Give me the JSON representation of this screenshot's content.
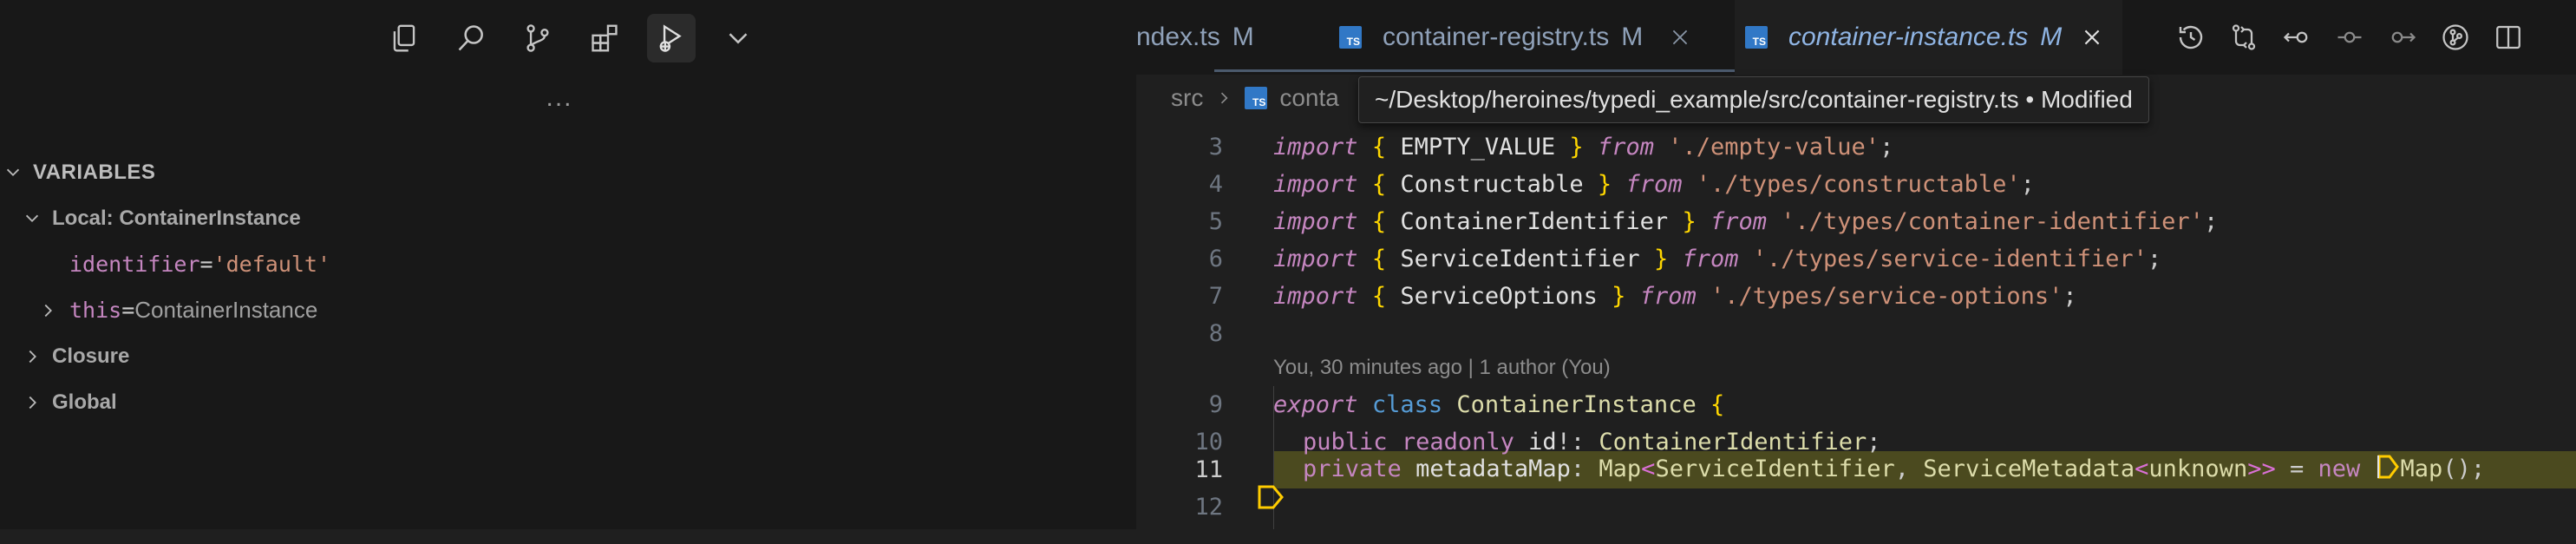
{
  "sidebar": {
    "toolbar_icons": [
      "copy-icon",
      "search-icon",
      "source-control-icon",
      "extensions-icon",
      "run-debug-icon",
      "chevron-down-icon"
    ],
    "more": "...",
    "variables": {
      "title": "VARIABLES",
      "scopes": [
        {
          "label": "Local: ContainerInstance",
          "expanded": true,
          "items": [
            {
              "name": "identifier",
              "eq": " = ",
              "value": "'default'"
            },
            {
              "name": "this",
              "eq": " = ",
              "value": "ContainerInstance"
            }
          ]
        },
        {
          "label": "Closure",
          "expanded": false
        },
        {
          "label": "Global",
          "expanded": false
        }
      ]
    }
  },
  "editor": {
    "tabs": [
      {
        "label": "ndex.ts",
        "status": "M"
      },
      {
        "label": "container-registry.ts",
        "status": "M"
      },
      {
        "label": "container-instance.ts",
        "status": "M",
        "active": true
      }
    ],
    "ts_badge": "TS",
    "breadcrumb": {
      "root": "src",
      "file": "conta"
    },
    "tooltip": {
      "path": "~/Desktop/heroines/typedi_example/src/container-registry.ts",
      "separator": " • ",
      "status": "Modified"
    },
    "blame": "You, 30 minutes ago | 1 author (You)",
    "line_numbers": [
      "3",
      "4",
      "5",
      "6",
      "7",
      "8",
      "9",
      "10",
      "11",
      "12"
    ],
    "lines": {
      "l3": {
        "kw": "import",
        "open": "{",
        "name": " EMPTY_VALUE ",
        "close": "}",
        "from": "from",
        "path": "'./empty-value'",
        "end": ";"
      },
      "l4": {
        "kw": "import",
        "open": "{",
        "name": " Constructable ",
        "close": "}",
        "from": "from",
        "path": "'./types/constructable'",
        "end": ";"
      },
      "l5": {
        "kw": "import",
        "open": "{",
        "name": " ContainerIdentifier ",
        "close": "}",
        "from": "from",
        "path": "'./types/container-identifier'",
        "end": ";"
      },
      "l6": {
        "kw": "import",
        "open": "{",
        "name": " ServiceIdentifier ",
        "close": "}",
        "from": "from",
        "path": "'./types/service-identifier'",
        "end": ";"
      },
      "l7": {
        "kw": "import",
        "open": "{",
        "name": " ServiceOptions ",
        "close": "}",
        "from": "from",
        "path": "'./types/service-options'",
        "end": ";"
      },
      "l9": {
        "export": "export",
        "class": "class",
        "name": "ContainerInstance",
        "open": "{"
      },
      "l10": {
        "public": "public",
        "readonly": "readonly",
        "prop": "id",
        "bang": "!: ",
        "type": "ContainerIdentifier",
        "end": ";"
      },
      "l11": {
        "private": "private",
        "prop": "metadataMap",
        "colon": ": ",
        "map": "Map",
        "lt": "<",
        "t1": "ServiceIdentifier",
        "comma": ", ",
        "t2": "ServiceMetadata",
        "lt2": "<",
        "t3": "unknown",
        "gt": ">>",
        "eq": " = ",
        "new": "new",
        "map2": "Map",
        "call": "();"
      }
    }
  }
}
